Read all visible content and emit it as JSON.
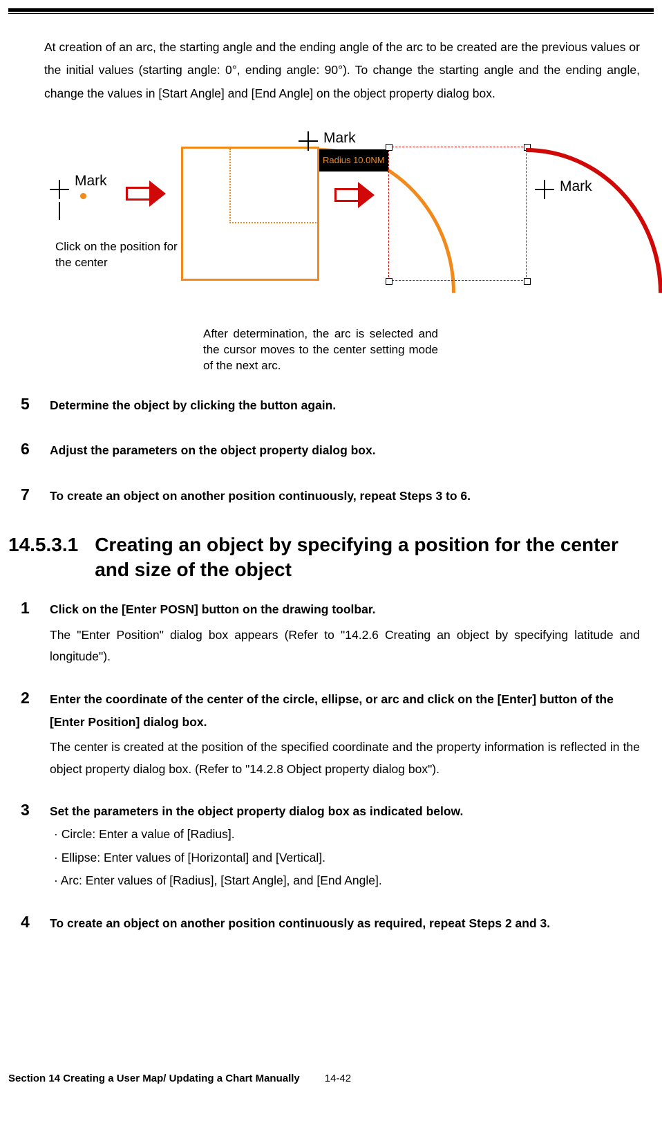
{
  "intro": "At creation of an arc, the starting angle and the ending angle of the arc to be created are the previous values or the initial values (starting angle: 0°, ending angle: 90°). To change the starting angle and the ending angle, change the values in [Start Angle] and [End Angle] on the object property dialog box.",
  "figure": {
    "mark1": "Mark",
    "mark2": "Mark",
    "mark3": "Mark",
    "badge": "Radius   10.0NM",
    "caption_left": "Click on the position for the center",
    "caption_bottom": "After determination, the arc is selected and the cursor moves to the center setting mode of the next arc."
  },
  "stepsA": [
    {
      "n": "5",
      "bold": "Determine the object by clicking the button again."
    },
    {
      "n": "6",
      "bold": "Adjust the parameters on the object property dialog box."
    },
    {
      "n": "7",
      "bold": "To create an object on another position continuously, repeat Steps 3 to 6."
    }
  ],
  "heading": {
    "no": "14.5.3.1",
    "title": "Creating an object by specifying a position for the center and size of the object"
  },
  "stepsB": [
    {
      "n": "1",
      "bold": "Click on the [Enter POSN] button on the drawing toolbar.",
      "body": "The \"Enter Position\" dialog box appears (Refer to \"14.2.6 Creating an object by specifying latitude and longitude\")."
    },
    {
      "n": "2",
      "bold": "Enter the coordinate of the center of the circle, ellipse, or arc and click on the [Enter] button of the [Enter Position] dialog box.",
      "body": "The center is created at the position of the specified coordinate and the property information is reflected in the object property dialog box. (Refer to \"14.2.8 Object property dialog box\")."
    },
    {
      "n": "3",
      "bold": "Set the parameters in the object property dialog box as indicated below.",
      "sub": [
        "· Circle: Enter a value of [Radius].",
        "· Ellipse: Enter values of [Horizontal] and [Vertical].",
        "· Arc: Enter values of [Radius], [Start Angle], and [End Angle]."
      ]
    },
    {
      "n": "4",
      "bold": "To create an object on another position continuously as required, repeat Steps 2 and 3."
    }
  ],
  "footer": {
    "section": "Section 14    Creating a User Map/ Updating a Chart Manually",
    "page": "14-42"
  }
}
